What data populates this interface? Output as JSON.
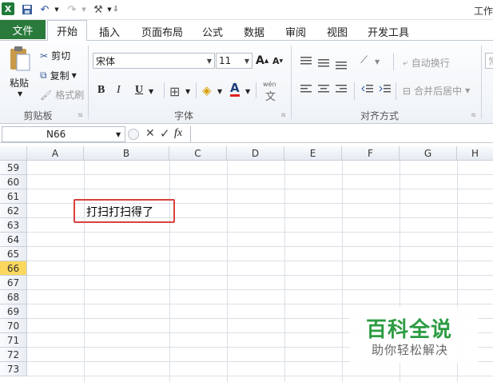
{
  "titlebar": {
    "logo": "X",
    "title": "工作",
    "icons": [
      "save-icon",
      "undo-icon",
      "redo-icon",
      "tools-icon",
      "customize-icon"
    ]
  },
  "tabs": [
    {
      "label": "文件"
    },
    {
      "label": "开始"
    },
    {
      "label": "插入"
    },
    {
      "label": "页面布局"
    },
    {
      "label": "公式"
    },
    {
      "label": "数据"
    },
    {
      "label": "审阅"
    },
    {
      "label": "视图"
    },
    {
      "label": "开发工具"
    }
  ],
  "clipboard": {
    "paste": "粘贴",
    "cut": "剪切",
    "copy": "复制",
    "format_painter": "格式刷",
    "group": "剪贴板"
  },
  "font": {
    "name": "宋体",
    "size": "11",
    "group": "字体",
    "bold": "B",
    "italic": "I",
    "underline": "U",
    "font_color": "A",
    "wen": "wén",
    "grow": "A",
    "shrink": "A"
  },
  "alignment": {
    "wrap": "自动换行",
    "merge": "合并后居中",
    "group": "对齐方式",
    "extra": "常"
  },
  "formula_bar": {
    "cell": "N66",
    "fx": "fx"
  },
  "columns": [
    "A",
    "B",
    "C",
    "D",
    "E",
    "F",
    "G",
    "H"
  ],
  "rows": [
    "59",
    "60",
    "61",
    "62",
    "63",
    "64",
    "65",
    "66",
    "67",
    "68",
    "69",
    "70",
    "71",
    "72",
    "73"
  ],
  "active_row": "66",
  "cell_text": "打扫打扫得了",
  "watermark": {
    "title": "百科全说",
    "subtitle": "助你轻松解决"
  }
}
